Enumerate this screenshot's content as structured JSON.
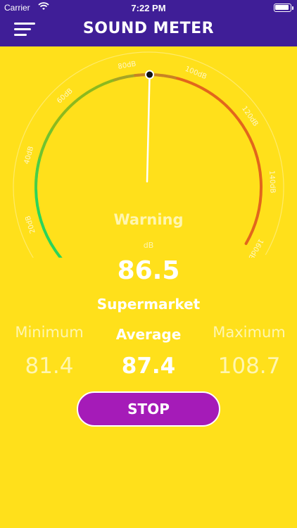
{
  "status_bar": {
    "carrier": "Carrier",
    "time": "7:22 PM"
  },
  "header": {
    "title": "SOUND METER",
    "menu_icon": "hamburger-menu-icon"
  },
  "gauge": {
    "ticks": [
      "0dB",
      "20dB",
      "40dB",
      "60dB",
      "80dB",
      "100dB",
      "120dB",
      "140dB",
      "160dB"
    ],
    "needle_value_db": 86.5,
    "range_db": [
      0,
      160
    ],
    "colors": {
      "low": "#2BD45A",
      "mid": "#8CB91E",
      "high": "#E2661C"
    }
  },
  "status": {
    "level": "Warning",
    "unit": "dB",
    "reading": "86.5",
    "place": "Supermarket"
  },
  "stats": {
    "minimum_label": "Minimum",
    "average_label": "Average",
    "maximum_label": "Maximum",
    "minimum_value": "81.4",
    "average_value": "87.4",
    "maximum_value": "108.7"
  },
  "actions": {
    "stop_label": "STOP"
  },
  "colors": {
    "header_bg": "#3F1E97",
    "body_bg": "#FFE01B",
    "button_bg": "#A51BB8"
  }
}
